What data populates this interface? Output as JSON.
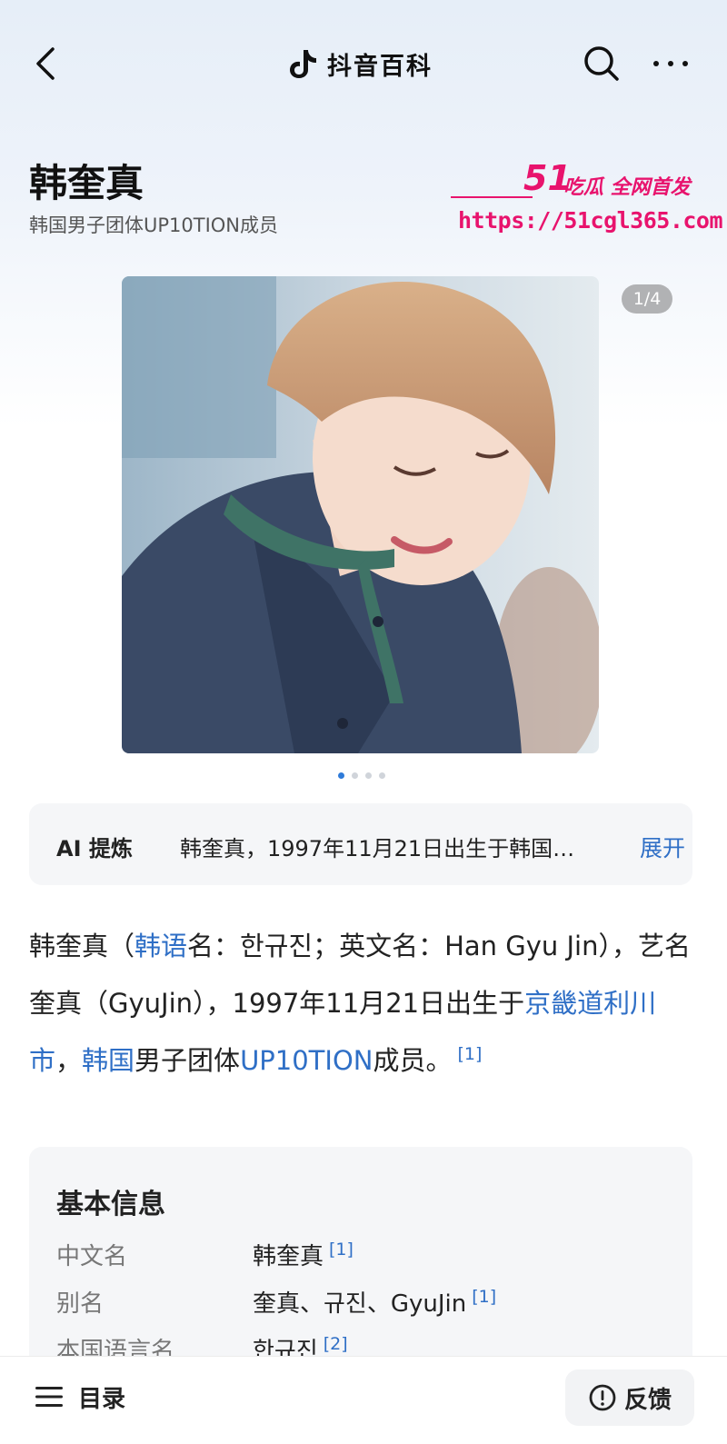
{
  "header": {
    "brand_name": "抖音百科",
    "icons": {
      "back": "back-chevron-icon",
      "logo": "douyin-note-icon",
      "search": "search-icon",
      "more": "more-dots-icon"
    }
  },
  "page": {
    "title": "韩奎真",
    "subtitle": "韩国男子团体UP10TION成员"
  },
  "watermark": {
    "brand_number": "51",
    "brand_tagline": "吃瓜 全网首发",
    "url": "https://51cgl365.com"
  },
  "gallery": {
    "counter": "1/4",
    "total": 4,
    "active_index": 0
  },
  "ai_summary": {
    "label": "AI 提炼",
    "text": "韩奎真，1997年11月21日出生于韩国…",
    "expand_label": "展开"
  },
  "intro": {
    "p1": "韩奎真（",
    "link1": "韩语",
    "p2": "名：한규진；英文名：Han Gyu Jin），艺名奎真（GyuJin），1997年11月21日出生于",
    "link2": "京畿道利川市",
    "p3": "，",
    "link3": "韩国",
    "p4": "男子团体",
    "link4": "UP10TION",
    "p5": "成员。",
    "ref": "[1]"
  },
  "info_box": {
    "title": "基本信息",
    "rows": [
      {
        "key": "中文名",
        "value": "韩奎真",
        "ref": "[1]"
      },
      {
        "key": "别名",
        "value": "奎真、규진、GyuJin",
        "ref": "[1]"
      },
      {
        "key": "本国语言名",
        "value": "한규진",
        "ref": "[2]"
      }
    ]
  },
  "bottom_bar": {
    "toc_label": "目录",
    "feedback_label": "反馈",
    "icons": {
      "toc": "menu-lines-icon",
      "feedback": "alert-circle-icon"
    }
  },
  "colors": {
    "link": "#2f6fc6",
    "watermark": "#e8136d",
    "dot_active": "#2f7bd9"
  }
}
